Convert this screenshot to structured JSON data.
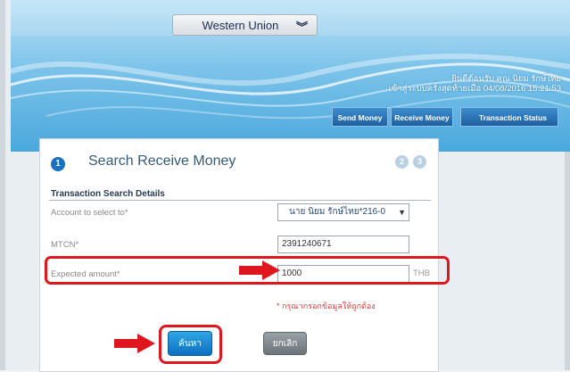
{
  "service_dropdown": {
    "value": "Western Union",
    "icon": "chevron-double-down-icon"
  },
  "welcome": {
    "line1": "ยินดีต้อนรับ คุณ นิยม รักษ์ไทย",
    "line2": "เข้าสู่ระบบครั้งสุดท้ายเมื่อ 04/08/2016 15:21:53"
  },
  "tabs": [
    {
      "label": "Send Money"
    },
    {
      "label": "Receive Money"
    },
    {
      "label": "Transaction Status"
    }
  ],
  "panel": {
    "step_current": "1",
    "step2": "2",
    "step3": "3",
    "title": "Search Receive Money",
    "section_title": "Transaction Search Details",
    "fields": [
      {
        "label": "Account to select to*",
        "value": "นาย นิยม รักษ์ไทย*216-0"
      },
      {
        "label": "MTCN*",
        "value": "2391240671"
      },
      {
        "label": "Expected amount*",
        "value": "1000",
        "unit": "THB"
      }
    ],
    "error": "* กรุณากรอกข้อมูลให้ถูกต้อง",
    "buttons": {
      "search": "ค้นหา",
      "cancel": "ยกเลิก"
    }
  },
  "colors": {
    "highlight": "#e0161e",
    "accent": "#1a72c2",
    "header": "#4aa8dc"
  }
}
